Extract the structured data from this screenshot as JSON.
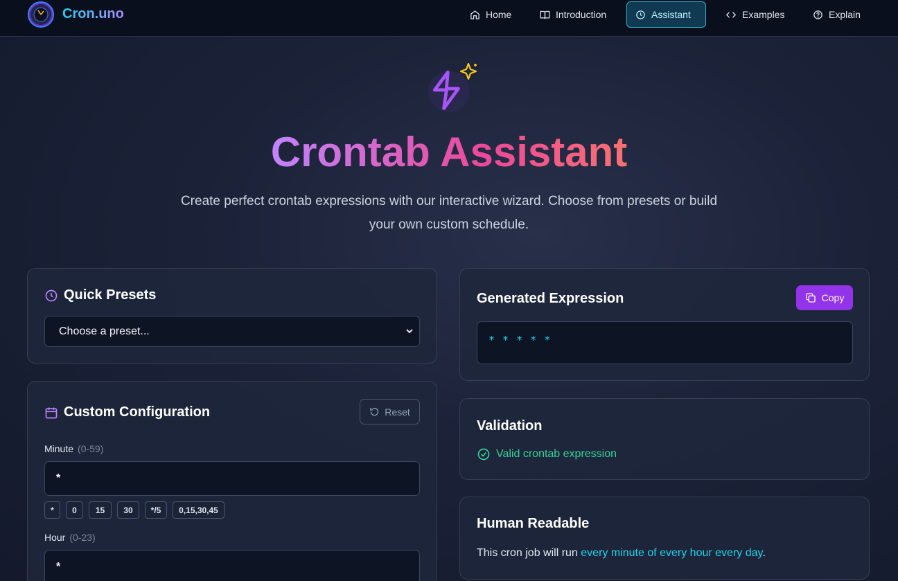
{
  "nav": {
    "brand": "Cron.uno",
    "items": [
      {
        "label": "Home",
        "icon": "home-icon"
      },
      {
        "label": "Introduction",
        "icon": "book-icon"
      },
      {
        "label": "Assistant",
        "icon": "clock-icon",
        "active": true
      },
      {
        "label": "Examples",
        "icon": "code-icon"
      },
      {
        "label": "Explain",
        "icon": "help-circle-icon"
      }
    ]
  },
  "hero": {
    "icon": "zap-sparkles-icon",
    "title": "Crontab Assistant",
    "subtitle": "Create perfect crontab expressions with our interactive wizard. Choose from presets or build your own custom schedule."
  },
  "presets": {
    "title": "Quick Presets",
    "select_value": "Choose a preset..."
  },
  "custom": {
    "title": "Custom Configuration",
    "reset_label": "Reset",
    "minute": {
      "label": "Minute",
      "range": "(0-59)",
      "value": "*",
      "chips": [
        "*",
        "0",
        "15",
        "30",
        "*/5",
        "0,15,30,45"
      ]
    },
    "hour": {
      "label": "Hour",
      "range": "(0-23)",
      "value": "*"
    }
  },
  "generated": {
    "title": "Generated Expression",
    "copy_label": "Copy",
    "expression": "* * * * *"
  },
  "validation": {
    "title": "Validation",
    "message": "Valid crontab expression"
  },
  "readable": {
    "title": "Human Readable",
    "prefix": "This cron job will run ",
    "highlight": "every minute of every hour every day",
    "suffix": "."
  },
  "colors": {
    "accent_purple": "#9333ea",
    "accent_cyan": "#22d3ee",
    "success_green": "#34d399"
  }
}
